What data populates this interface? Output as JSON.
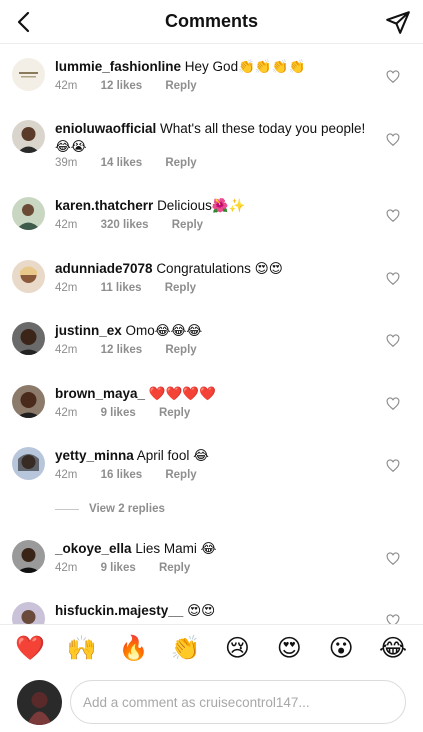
{
  "header": {
    "title": "Comments"
  },
  "comments": [
    {
      "username": "lummie_fashionline",
      "text": "Hey God👏👏👏👏",
      "time": "42m",
      "likes": "12 likes",
      "reply": "Reply"
    },
    {
      "username": "enioluwaofficial",
      "text": "What's all these today you people! 😂😭",
      "time": "39m",
      "likes": "14 likes",
      "reply": "Reply"
    },
    {
      "username": "karen.thatcherr",
      "text": "Delicious🌺✨",
      "time": "42m",
      "likes": "320 likes",
      "reply": "Reply"
    },
    {
      "username": "adunniade7078",
      "text": "Congratulations 😍😍",
      "time": "42m",
      "likes": "11 likes",
      "reply": "Reply"
    },
    {
      "username": "justinn_ex",
      "text": "Omo😂😂😂",
      "time": "42m",
      "likes": "12 likes",
      "reply": "Reply"
    },
    {
      "username": "brown_maya_",
      "text": "❤️❤️❤️❤️",
      "time": "42m",
      "likes": "9 likes",
      "reply": "Reply"
    },
    {
      "username": "yetty_minna",
      "text": "April fool 😂",
      "time": "42m",
      "likes": "16 likes",
      "reply": "Reply"
    },
    {
      "username": "_okoye_ella",
      "text": "Lies Mami 😂",
      "time": "42m",
      "likes": "9 likes",
      "reply": "Reply"
    },
    {
      "username": "hisfuckin.majesty__",
      "text": "😍😍",
      "time": "",
      "likes": "",
      "reply": ""
    }
  ],
  "view_replies": "View 2 replies",
  "emoji_bar": [
    "❤️",
    "🙌",
    "🔥",
    "👏",
    "😢",
    "😍",
    "😮",
    "😂"
  ],
  "comment_input": {
    "placeholder": "Add a comment as cruisecontrol147..."
  },
  "colors": {
    "text": "#111111",
    "meta": "#8e8e8e",
    "divider": "#ececec",
    "input_border": "#dbdbdb"
  },
  "icons": {
    "back": "chevron-left-icon",
    "send": "paper-plane-icon",
    "like": "heart-outline-icon"
  }
}
